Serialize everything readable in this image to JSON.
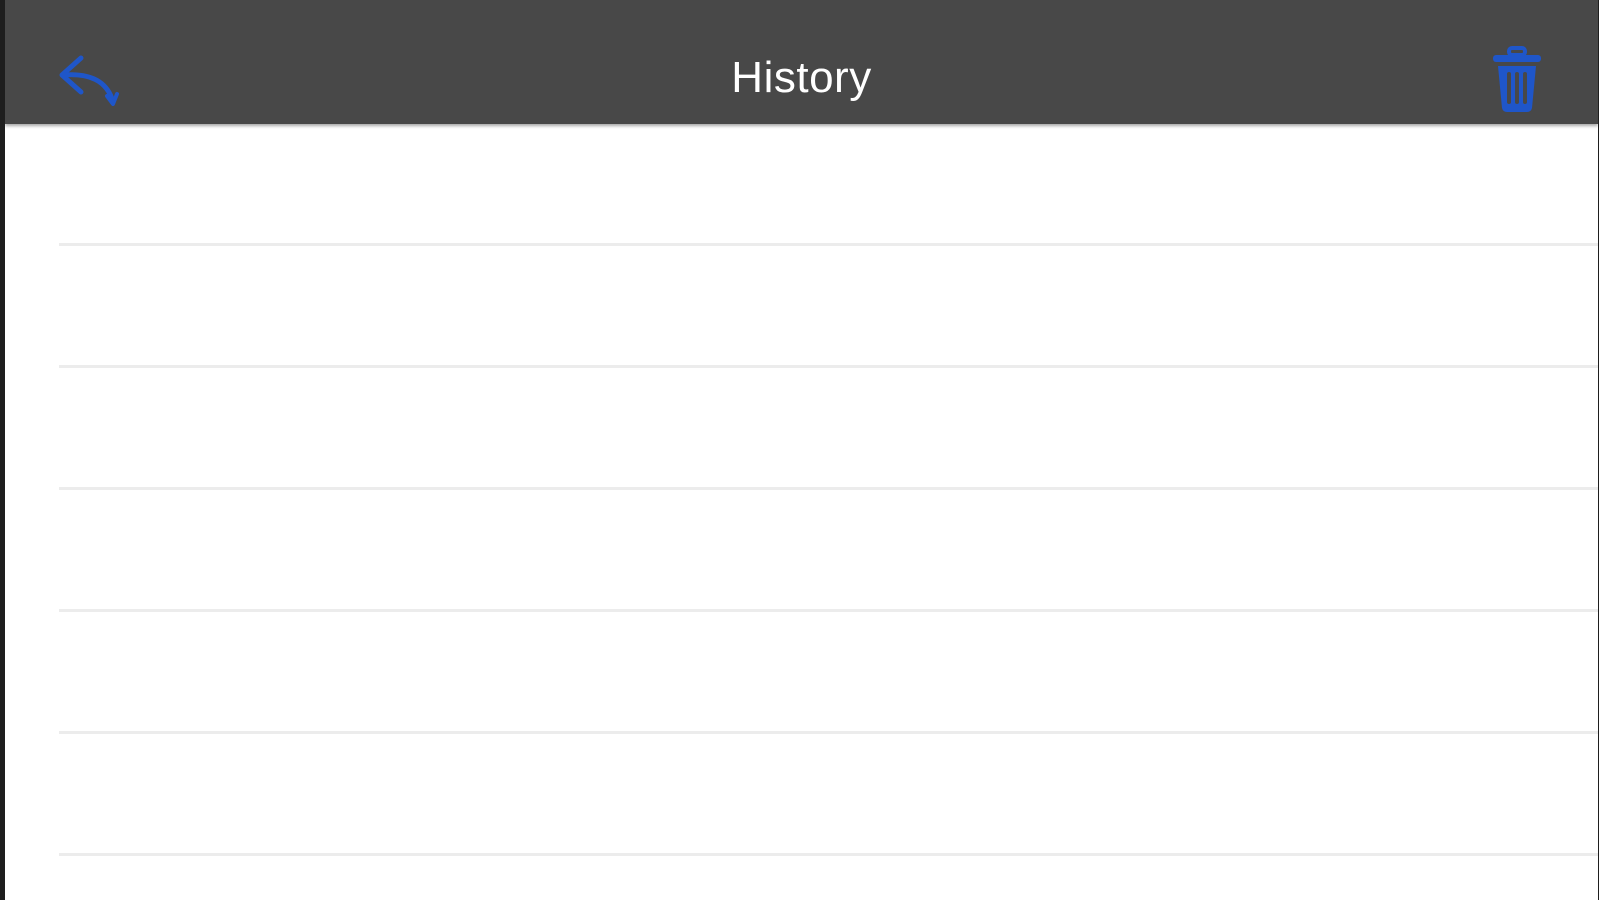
{
  "navbar": {
    "title": "History",
    "back_icon": "reply-arrow-icon",
    "delete_icon": "trash-icon",
    "accent_color": "#1f56c9",
    "background_color": "#484848"
  },
  "history": {
    "items": []
  }
}
